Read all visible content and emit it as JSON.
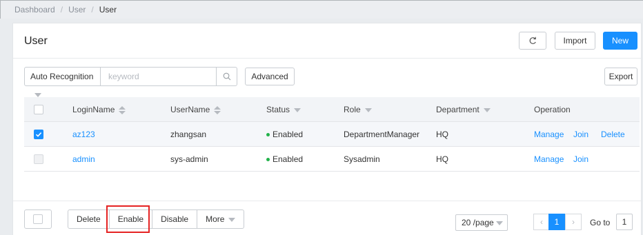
{
  "breadcrumb": [
    "Dashboard",
    "User",
    "User"
  ],
  "page_title": "User",
  "toolbar": {
    "refresh_icon": "refresh-icon",
    "import_label": "Import",
    "new_label": "New"
  },
  "filter": {
    "mode": "Auto Recognition",
    "placeholder": "keyword",
    "advanced_label": "Advanced"
  },
  "export_label": "Export",
  "table": {
    "headers": [
      "LoginName",
      "UserName",
      "Status",
      "Role",
      "Department",
      "Operation"
    ],
    "rows": [
      {
        "checked": true,
        "login": "az123",
        "username": "zhangsan",
        "status": "Enabled",
        "role": "DepartmentManager",
        "department": "HQ",
        "ops": [
          "Manage",
          "Join",
          "Delete"
        ]
      },
      {
        "checked": false,
        "login": "admin",
        "username": "sys-admin",
        "status": "Enabled",
        "role": "Sysadmin",
        "department": "HQ",
        "ops": [
          "Manage",
          "Join"
        ]
      }
    ]
  },
  "bulk_actions": [
    "Delete",
    "Enable",
    "Disable",
    "More"
  ],
  "pagination": {
    "page_size": "20 /page",
    "current_page": "1",
    "goto_label": "Go to",
    "goto_value": "1"
  },
  "colors": {
    "primary": "#1890ff",
    "status_enabled": "#21b24a",
    "highlight": "#e52222"
  }
}
